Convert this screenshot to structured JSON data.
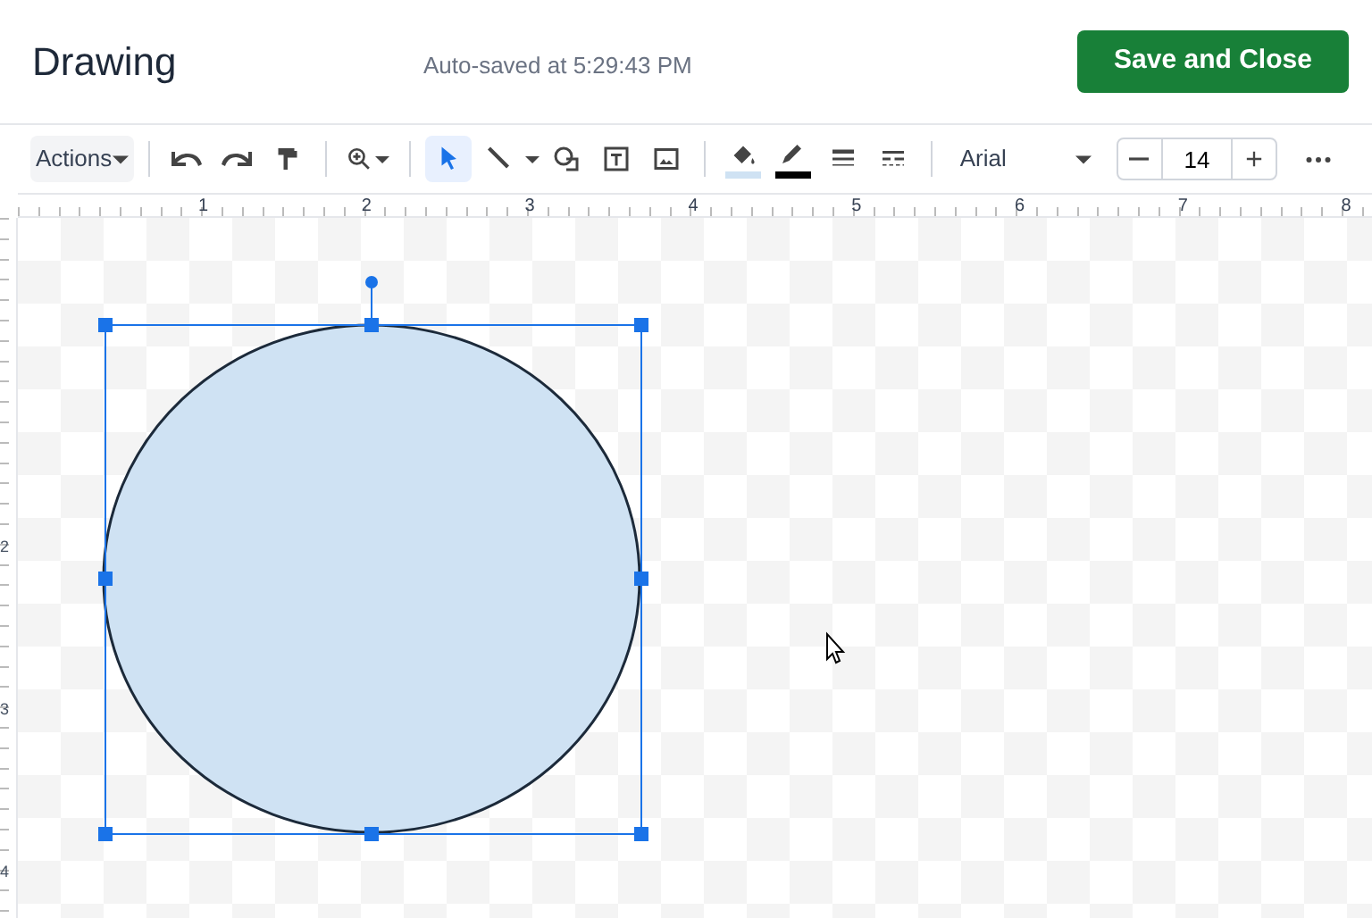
{
  "header": {
    "title": "Drawing",
    "autosave": "Auto-saved at 5:29:43 PM",
    "save_button": "Save and Close"
  },
  "toolbar": {
    "actions_menu": "Actions",
    "tools": [
      {
        "selected": true
      },
      {
        "selected": false
      },
      {
        "selected": false
      },
      {
        "selected": false
      },
      {
        "selected": false
      }
    ],
    "font": "Arial",
    "font_size": "14"
  },
  "rulers": {
    "horizontal": [
      "1",
      "2",
      "3",
      "4",
      "5",
      "6",
      "7",
      "8"
    ],
    "vertical": [
      "2",
      "3",
      "4"
    ]
  },
  "canvas": {
    "shape": {
      "kind": "ellipse",
      "selected": true
    }
  }
}
